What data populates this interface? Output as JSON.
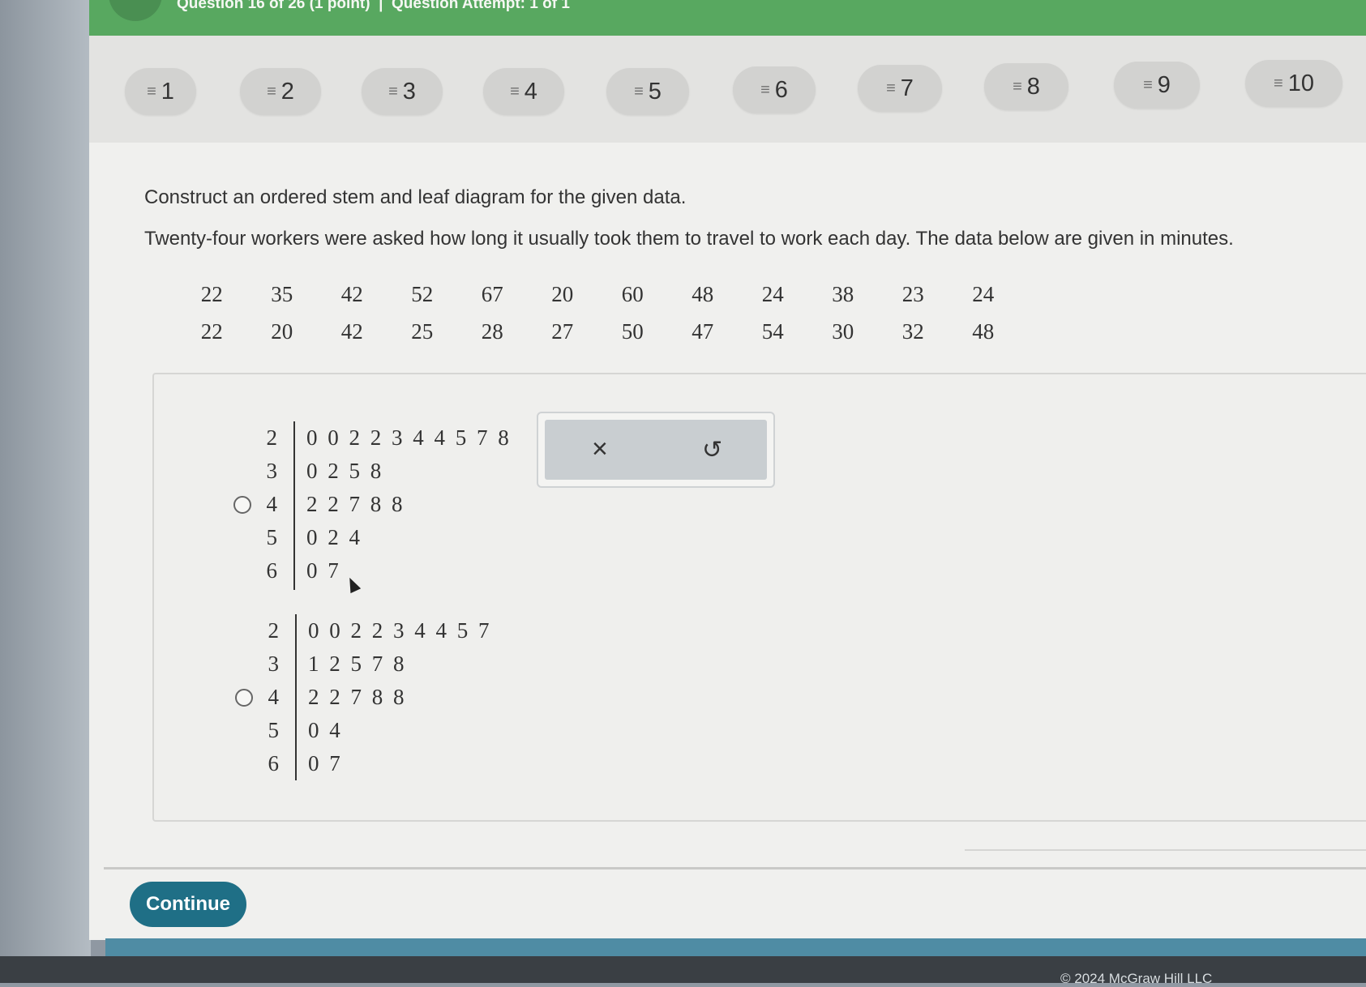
{
  "header": {
    "text": "Question 16 of 26 (1 point)  |  Question Attempt: 1 of 1"
  },
  "nav": {
    "items": [
      {
        "label": "1"
      },
      {
        "label": "2"
      },
      {
        "label": "3"
      },
      {
        "label": "4"
      },
      {
        "label": "5"
      },
      {
        "label": "6"
      },
      {
        "label": "7"
      },
      {
        "label": "8"
      },
      {
        "label": "9"
      },
      {
        "label": "10"
      }
    ]
  },
  "question": {
    "prompt": "Construct an ordered stem and leaf diagram for the given data.",
    "description": "Twenty-four workers were asked how long it usually took them to travel to work each day. The data below are given in minutes.",
    "data_rows": [
      [
        "22",
        "35",
        "42",
        "52",
        "67",
        "20",
        "60",
        "48",
        "24",
        "38",
        "23",
        "24"
      ],
      [
        "22",
        "20",
        "42",
        "25",
        "28",
        "27",
        "50",
        "47",
        "54",
        "30",
        "32",
        "48"
      ]
    ]
  },
  "options": [
    {
      "rows": [
        {
          "stem": "2",
          "leaves": "0 0 2 2 3 4 4 5 7 8"
        },
        {
          "stem": "3",
          "leaves": "0 2 5 8"
        },
        {
          "stem": "4",
          "leaves": "2 2 7 8 8"
        },
        {
          "stem": "5",
          "leaves": "0 2 4"
        },
        {
          "stem": "6",
          "leaves": "0 7"
        }
      ]
    },
    {
      "rows": [
        {
          "stem": "2",
          "leaves": "0 0 2 2 3 4 4 5 7"
        },
        {
          "stem": "3",
          "leaves": "1 2 5 7 8"
        },
        {
          "stem": "4",
          "leaves": "2 2 7 8 8"
        },
        {
          "stem": "5",
          "leaves": "0 4"
        },
        {
          "stem": "6",
          "leaves": "0 7"
        }
      ]
    }
  ],
  "tools": {
    "clear_glyph": "×",
    "undo_glyph": "↺"
  },
  "footer": {
    "continue_label": "Continue",
    "copyright": "© 2024 McGraw Hill LLC"
  },
  "colors": {
    "header": "#58a860",
    "continue": "#1f6f86",
    "footer_band": "#4f8ca4"
  }
}
